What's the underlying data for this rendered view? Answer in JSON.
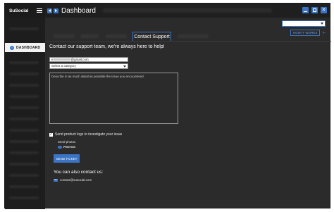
{
  "app": {
    "name": "SuSocial",
    "page_title": "Dashboard"
  },
  "sidebar": {
    "active_item": "DASHBOARD"
  },
  "toolbar": {
    "how_it_works": "HOW IT WORKS",
    "add": "+"
  },
  "tabs": {
    "active": "Contact Support"
  },
  "form": {
    "headline": "Contact our support team, we're always here to help!",
    "email_prefix": "e",
    "email_domain": "@gmail.com",
    "category_placeholder": "Select a category",
    "message_placeholder": "Describe in as much detail as possible the issue you encountered.",
    "send_logs_label": "Send product logs to investigate your issue",
    "send_logs_checked": true,
    "send_photos_label": "Send photos",
    "photos_toggle_label": "PHOTOS",
    "submit_label": "SEND TICKET"
  },
  "contact": {
    "heading": "You can also contact us:",
    "email": "contact@susocial.com"
  },
  "icons": [
    "hamburger-icon",
    "back-arrow-icon",
    "forward-arrow-icon",
    "minimize-icon",
    "maximize-icon",
    "close-icon",
    "check-circle-icon",
    "mail-icon"
  ],
  "colors": {
    "accent": "#3b74c4",
    "background": "#2b2b2b",
    "sidebar": "#1d1d1d"
  }
}
